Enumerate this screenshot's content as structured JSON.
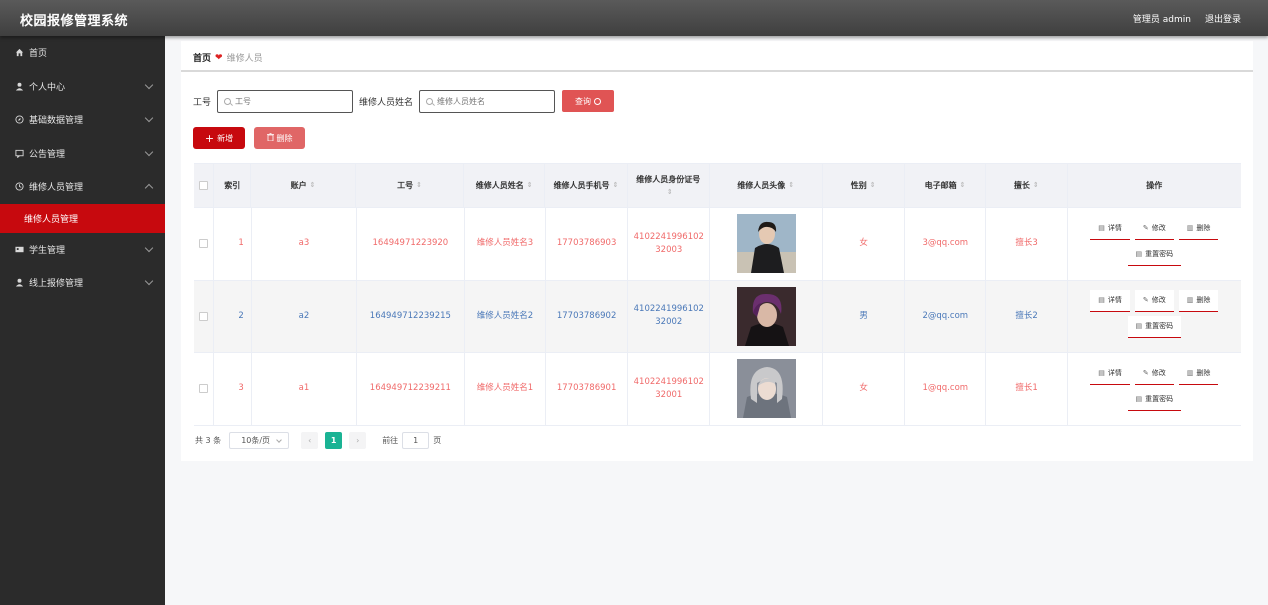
{
  "header": {
    "app_title": "校园报修管理系统",
    "admin_label": "管理员 admin",
    "logout_label": "退出登录"
  },
  "sidebar": {
    "items": [
      {
        "label": "首页",
        "icon": "home-icon"
      },
      {
        "label": "个人中心",
        "icon": "user-icon"
      },
      {
        "label": "基础数据管理",
        "icon": "compass-icon"
      },
      {
        "label": "公告管理",
        "icon": "message-icon"
      },
      {
        "label": "维修人员管理",
        "icon": "clock-icon"
      },
      {
        "label": "学生管理",
        "icon": "card-icon"
      },
      {
        "label": "线上报修管理",
        "icon": "user-icon"
      }
    ],
    "active_submenu": "维修人员管理"
  },
  "breadcrumb": {
    "home": "首页",
    "current": "维修人员"
  },
  "search": {
    "no_label": "工号",
    "no_placeholder": "工号",
    "name_label": "维修人员姓名",
    "name_placeholder": "维修人员姓名",
    "query_label": "查询"
  },
  "actions": {
    "add_label": "新增",
    "delete_label": "删除"
  },
  "table": {
    "headers": [
      "索引",
      "账户",
      "工号",
      "维修人员姓名",
      "维修人员手机号",
      "维修人员身份证号",
      "维修人员头像",
      "性别",
      "电子邮箱",
      "擅长",
      "操作"
    ],
    "rows": [
      {
        "index": "1",
        "account": "a3",
        "no": "16494971223920",
        "name": "维修人员姓名3",
        "phone": "17703786903",
        "id_card": "410224199610232003",
        "gender": "女",
        "email": "3@qq.com",
        "specialty": "擅长3"
      },
      {
        "index": "2",
        "account": "a2",
        "no": "164949712239215",
        "name": "维修人员姓名2",
        "phone": "17703786902",
        "id_card": "410224199610232002",
        "gender": "男",
        "email": "2@qq.com",
        "specialty": "擅长2"
      },
      {
        "index": "3",
        "account": "a1",
        "no": "164949712239211",
        "name": "维修人员姓名1",
        "phone": "17703786901",
        "id_card": "410224199610232001",
        "gender": "女",
        "email": "1@qq.com",
        "specialty": "擅长1"
      }
    ],
    "row_actions": {
      "detail": "详情",
      "edit": "修改",
      "delete": "删除",
      "reset_password": "重置密码"
    }
  },
  "pagination": {
    "total": "共 3 条",
    "page_size": "10条/页",
    "current_page": "1",
    "goto_label": "前往",
    "goto_value": "1",
    "page_suffix": "页"
  },
  "colors": {
    "brand_red": "#c7090e",
    "query_red": "#e05454",
    "pager_green": "#1ab394"
  }
}
